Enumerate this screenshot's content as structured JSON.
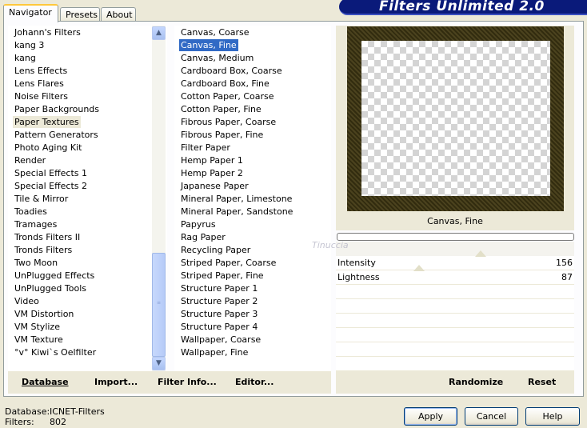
{
  "tabs": [
    {
      "label": "Navigator"
    },
    {
      "label": "Presets"
    },
    {
      "label": "About"
    }
  ],
  "banner": {
    "title": "Filters Unlimited 2.0"
  },
  "categories": [
    "Johann's Filters",
    "kang 3",
    "kang",
    "Lens Effects",
    "Lens Flares",
    "Noise Filters",
    "Paper Backgrounds",
    "Paper Textures",
    "Pattern Generators",
    "Photo Aging Kit",
    "Render",
    "Special Effects 1",
    "Special Effects 2",
    "Tile & Mirror",
    "Toadies",
    "Tramages",
    "Tronds Filters II",
    "Tronds Filters",
    "Two Moon",
    "UnPlugged Effects",
    "UnPlugged Tools",
    "Video",
    "VM Distortion",
    "VM Stylize",
    "VM Texture",
    "°v° Kiwi`s Oelfilter"
  ],
  "selected_category": "Paper Textures",
  "filters": [
    "Canvas, Coarse",
    "Canvas, Fine",
    "Canvas, Medium",
    "Cardboard Box, Coarse",
    "Cardboard Box, Fine",
    "Cotton Paper, Coarse",
    "Cotton Paper, Fine",
    "Fibrous Paper, Coarse",
    "Fibrous Paper, Fine",
    "Filter Paper",
    "Hemp Paper 1",
    "Hemp Paper 2",
    "Japanese Paper",
    "Mineral Paper, Limestone",
    "Mineral Paper, Sandstone",
    "Papyrus",
    "Rag Paper",
    "Recycling Paper",
    "Striped Paper, Coarse",
    "Striped Paper, Fine",
    "Structure Paper 1",
    "Structure Paper 2",
    "Structure Paper 3",
    "Structure Paper 4",
    "Wallpaper, Coarse",
    "Wallpaper, Fine"
  ],
  "selected_filter": "Canvas, Fine",
  "preview_filter_name": "Canvas, Fine",
  "params": [
    {
      "label": "Intensity",
      "value": "156",
      "level": 156
    },
    {
      "label": "Lightness",
      "value": "87",
      "level": 87
    }
  ],
  "param_range_max": 255,
  "buttons": {
    "database": "Database",
    "import": "Import...",
    "filter_info": "Filter Info...",
    "editor": "Editor...",
    "randomize": "Randomize",
    "reset": "Reset",
    "apply": "Apply",
    "cancel": "Cancel",
    "help": "Help"
  },
  "footer": {
    "database_label": "Database:",
    "database_value": "ICNET-Filters",
    "filters_label": "Filters:",
    "filters_value": "802"
  },
  "watermark": "Tinuccia",
  "colors": {
    "selection_blue": "#316ac5",
    "banner_blue": "#0a1a7a",
    "panel_bg": "#ece9d8"
  }
}
